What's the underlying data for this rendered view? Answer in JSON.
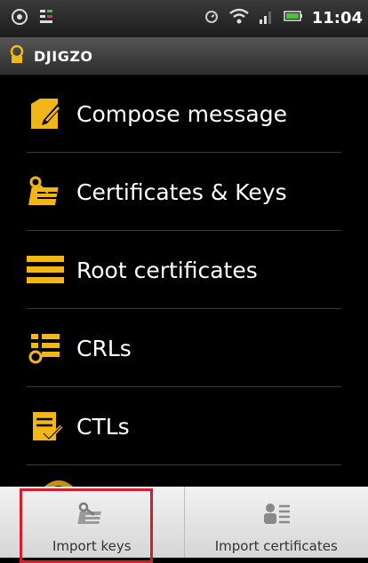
{
  "status_bar": {
    "time": "11:04",
    "icons": [
      "sync-icon",
      "notification-icon",
      "alarm-icon",
      "wifi-icon",
      "signal-icon",
      "battery-icon"
    ]
  },
  "app": {
    "title": "DJIGZO",
    "icon": "djigzo-app-icon"
  },
  "menu": {
    "items": [
      {
        "label": "Compose message",
        "icon": "compose-icon"
      },
      {
        "label": "Certificates & Keys",
        "icon": "certificates-keys-icon"
      },
      {
        "label": "Root certificates",
        "icon": "root-certificates-icon"
      },
      {
        "label": "CRLs",
        "icon": "crls-icon"
      },
      {
        "label": "CTLs",
        "icon": "ctls-icon"
      }
    ]
  },
  "bottom_menu": {
    "import_keys": "Import keys",
    "import_certificates": "Import certificates"
  },
  "colors": {
    "icon_accent": "#f2b617",
    "highlight": "#d21f2b",
    "background": "#000000"
  }
}
